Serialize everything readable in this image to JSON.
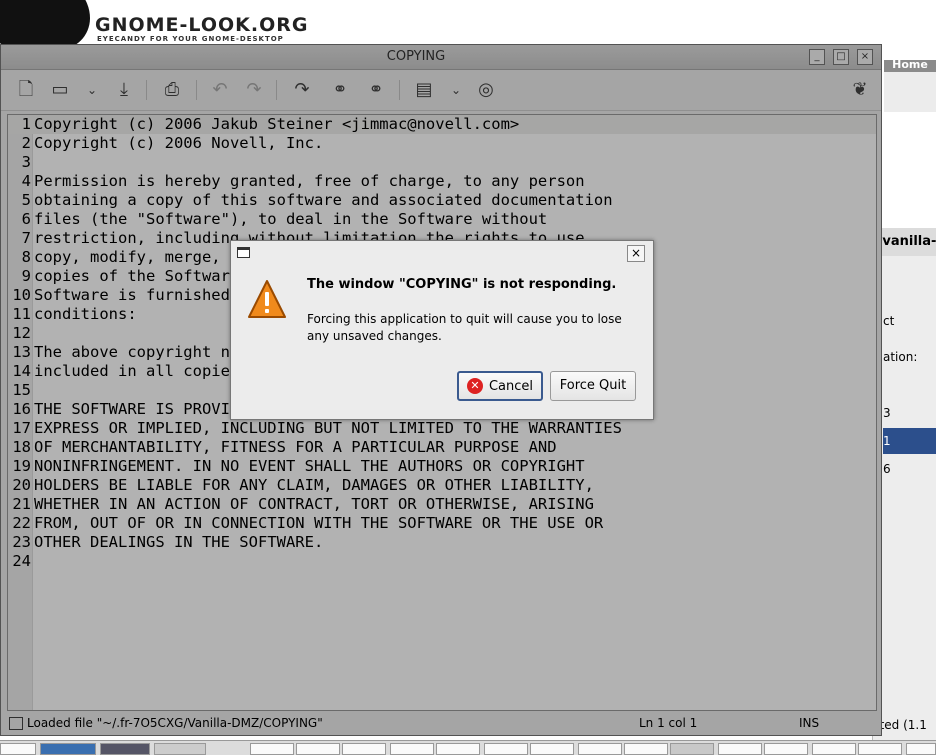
{
  "website": {
    "logo_text": "GNOME-LOOK.ORG",
    "logo_tagline": "EYECANDY FOR YOUR GNOME-DESKTOP",
    "nav_home": "Home"
  },
  "background_window": {
    "title_fragment": "-vanilla-",
    "fragments": [
      "ct",
      "ation:",
      "3",
      "1",
      "6",
      "cted (1.1"
    ]
  },
  "editor_window": {
    "title": "COPYING",
    "wm_buttons": [
      "_",
      "□",
      "×"
    ],
    "toolbar_icons": [
      "new-file-icon",
      "open-file-icon",
      "dropdown-arrow-icon",
      "save-icon",
      "print-icon",
      "undo-icon",
      "redo-icon",
      "find-icon",
      "find-replace-icon",
      "indent-icon",
      "dropdown-arrow-icon",
      "help-icon",
      "gnome-foot-icon"
    ],
    "lines": [
      {
        "n": "1",
        "t": "Copyright (c) 2006 Jakub Steiner <jimmac@novell.com>"
      },
      {
        "n": "2",
        "t": "Copyright (c) 2006 Novell, Inc."
      },
      {
        "n": "3",
        "t": ""
      },
      {
        "n": "4",
        "t": "Permission is hereby granted, free of charge, to any person"
      },
      {
        "n": "5",
        "t": "obtaining a copy of this software and associated documentation"
      },
      {
        "n": "6",
        "t": "files (the \"Software\"), to deal in the Software without"
      },
      {
        "n": "7",
        "t": "restriction, including without limitation the rights to use,"
      },
      {
        "n": "8",
        "t": "copy, modify, merge, publish, distribute, sublicense, and/or sell"
      },
      {
        "n": "9",
        "t": "copies of the Software, and to permit persons to whom the"
      },
      {
        "n": "10",
        "t": "Software is furnished to do so, subject to the following"
      },
      {
        "n": "11",
        "t": "conditions:"
      },
      {
        "n": "12",
        "t": ""
      },
      {
        "n": "13",
        "t": "The above copyright notice and this permission notice shall be"
      },
      {
        "n": "14",
        "t": "included in all copies or substantial portions of the Software."
      },
      {
        "n": "15",
        "t": ""
      },
      {
        "n": "16",
        "t": "THE SOFTWARE IS PROVIDED \"AS IS\", WITHOUT WARRANTY OF ANY KIND,"
      },
      {
        "n": "17",
        "t": "EXPRESS OR IMPLIED, INCLUDING BUT NOT LIMITED TO THE WARRANTIES"
      },
      {
        "n": "18",
        "t": "OF MERCHANTABILITY, FITNESS FOR A PARTICULAR PURPOSE AND"
      },
      {
        "n": "19",
        "t": "NONINFRINGEMENT. IN NO EVENT SHALL THE AUTHORS OR COPYRIGHT"
      },
      {
        "n": "20",
        "t": "HOLDERS BE LIABLE FOR ANY CLAIM, DAMAGES OR OTHER LIABILITY,"
      },
      {
        "n": "21",
        "t": "WHETHER IN AN ACTION OF CONTRACT, TORT OR OTHERWISE, ARISING"
      },
      {
        "n": "22",
        "t": "FROM, OUT OF OR IN CONNECTION WITH THE SOFTWARE OR THE USE OR"
      },
      {
        "n": "23",
        "t": "OTHER DEALINGS IN THE SOFTWARE."
      },
      {
        "n": "24",
        "t": ""
      }
    ],
    "status": {
      "message": "Loaded file \"~/.fr-7O5CXG/Vanilla-DMZ/COPYING\"",
      "position": "Ln 1 col 1",
      "mode": "INS"
    }
  },
  "dialog": {
    "heading": "The window \"COPYING\" is not responding.",
    "body": "Forcing this application to quit will cause you to lose any unsaved changes.",
    "cancel_label": "Cancel",
    "force_quit_label": "Force Quit",
    "close_glyph": "×"
  },
  "colors": {
    "selection_blue": "#2c4f8c",
    "warning_orange": "#f08a1c"
  }
}
